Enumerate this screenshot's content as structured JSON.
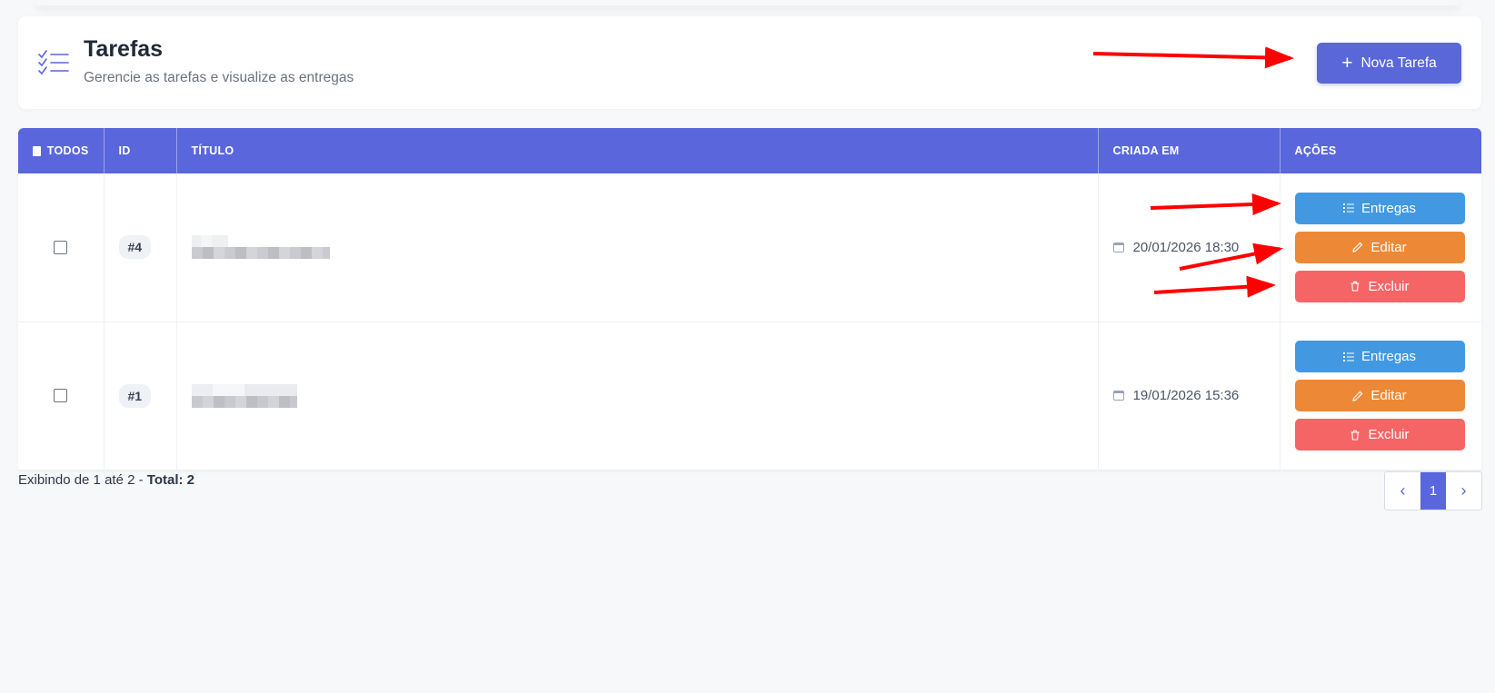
{
  "header": {
    "title": "Tarefas",
    "subtitle": "Gerencie as tarefas e visualize as entregas",
    "new_button_label": "Nova Tarefa"
  },
  "table": {
    "columns": {
      "all": "TODOS",
      "id": "ID",
      "title": "TÍTULO",
      "created": "CRIADA EM",
      "actions": "AÇÕES"
    },
    "rows": [
      {
        "id": "#4",
        "created": "20/01/2026 18:30"
      },
      {
        "id": "#1",
        "created": "19/01/2026 15:36"
      }
    ],
    "action_labels": {
      "deliveries": "Entregas",
      "edit": "Editar",
      "delete": "Excluir"
    }
  },
  "footer": {
    "showing": "Exibindo de 1 até 2 - ",
    "total": "Total: 2",
    "current_page": "1"
  },
  "colors": {
    "primary": "#5a67d8",
    "deliveries": "#4299e1",
    "edit": "#ed8936",
    "delete": "#f56565",
    "annotation_arrow": "#ff0000"
  }
}
